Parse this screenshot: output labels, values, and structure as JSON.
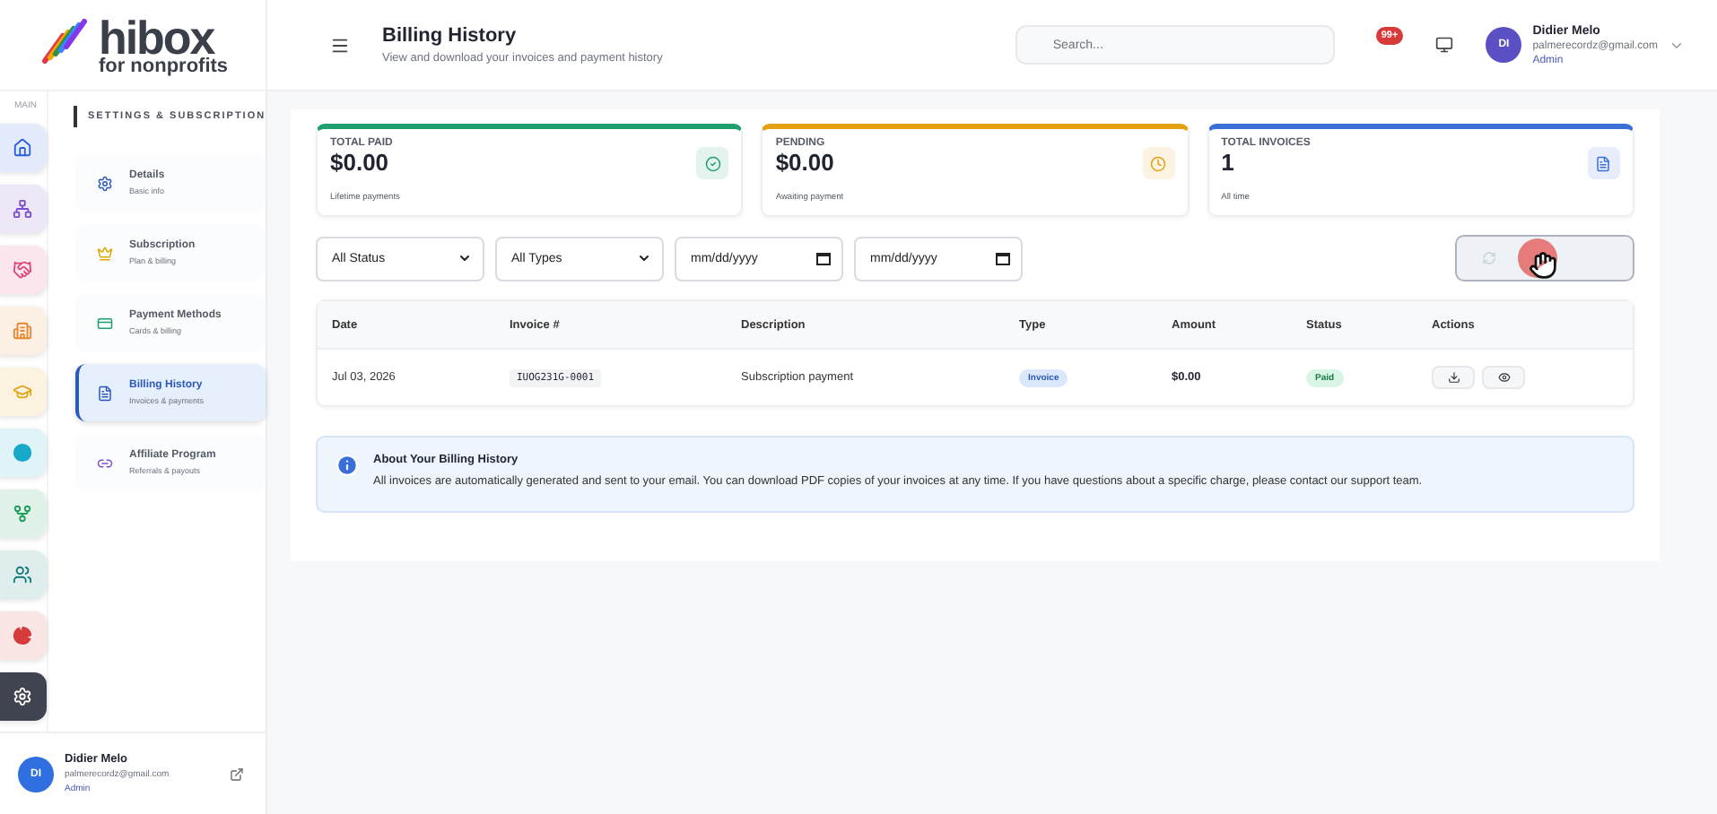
{
  "logo": {
    "name": "hibox",
    "tagline": "for nonprofits"
  },
  "rail": {
    "label": "MAIN",
    "items": [
      {
        "selected": false,
        "color": "#2b5fd9"
      },
      {
        "selected": false,
        "color": "#7c4dcc"
      },
      {
        "selected": false,
        "color": "#e0457b"
      },
      {
        "selected": false,
        "color": "#e9862a"
      },
      {
        "selected": false,
        "color": "#e3a512"
      },
      {
        "selected": false,
        "color": "#17a9c9"
      },
      {
        "selected": false,
        "color": "#1f9e5c"
      },
      {
        "selected": false,
        "color": "#127a7a"
      },
      {
        "selected": false,
        "color": "#d63a3a"
      },
      {
        "selected": true,
        "color": "#ffffff"
      }
    ]
  },
  "subnav": {
    "heading": "SETTINGS & SUBSCRIPTION",
    "items": [
      {
        "title": "Details",
        "subtitle": "Basic info",
        "selected": false
      },
      {
        "title": "Subscription",
        "subtitle": "Plan & billing",
        "selected": false
      },
      {
        "title": "Payment Methods",
        "subtitle": "Cards & billing",
        "selected": false
      },
      {
        "title": "Billing History",
        "subtitle": "Invoices & payments",
        "selected": true
      },
      {
        "title": "Affiliate Program",
        "subtitle": "Referrals & payouts",
        "selected": false
      }
    ]
  },
  "sidebar_user": {
    "initials": "DI",
    "name": "Didier Melo",
    "email": "palmerecordz@gmail.com",
    "role": "Admin"
  },
  "header": {
    "title": "Billing History",
    "subtitle": "View and download your invoices and payment history",
    "search": {
      "placeholder": "Search..."
    },
    "notification_count": "99+",
    "user": {
      "initials": "DI",
      "name": "Didier Melo",
      "email": "palmerecordz@gmail.com",
      "role": "Admin"
    }
  },
  "stats": [
    {
      "label": "TOTAL PAID",
      "value": "$0.00",
      "note": "Lifetime payments",
      "color": "#1f9e6e"
    },
    {
      "label": "PENDING",
      "value": "$0.00",
      "note": "Awaiting payment",
      "color": "#e3a012"
    },
    {
      "label": "TOTAL INVOICES",
      "value": "1",
      "note": "All time",
      "color": "#3b6fd8"
    }
  ],
  "filters": [
    {
      "kind": "select",
      "value": "All Status"
    },
    {
      "kind": "select",
      "value": "All Types"
    },
    {
      "kind": "date",
      "placeholder": "mm/dd/yyyy"
    },
    {
      "kind": "date",
      "placeholder": "mm/dd/yyyy"
    }
  ],
  "table": {
    "columns": [
      "Date",
      "Invoice #",
      "Description",
      "Type",
      "Amount",
      "Status",
      "Actions"
    ],
    "rows": [
      {
        "date": "Jul 03, 2026",
        "invoice": "IUOG231G-0001",
        "description": "Subscription payment",
        "type": "Invoice",
        "amount": "$0.00",
        "status": "Paid"
      }
    ]
  },
  "info": {
    "title": "About Your Billing History",
    "text": "All invoices are automatically generated and sent to your email. You can download PDF copies of your invoices at any time. If you have questions about a specific charge, please contact our support team."
  }
}
